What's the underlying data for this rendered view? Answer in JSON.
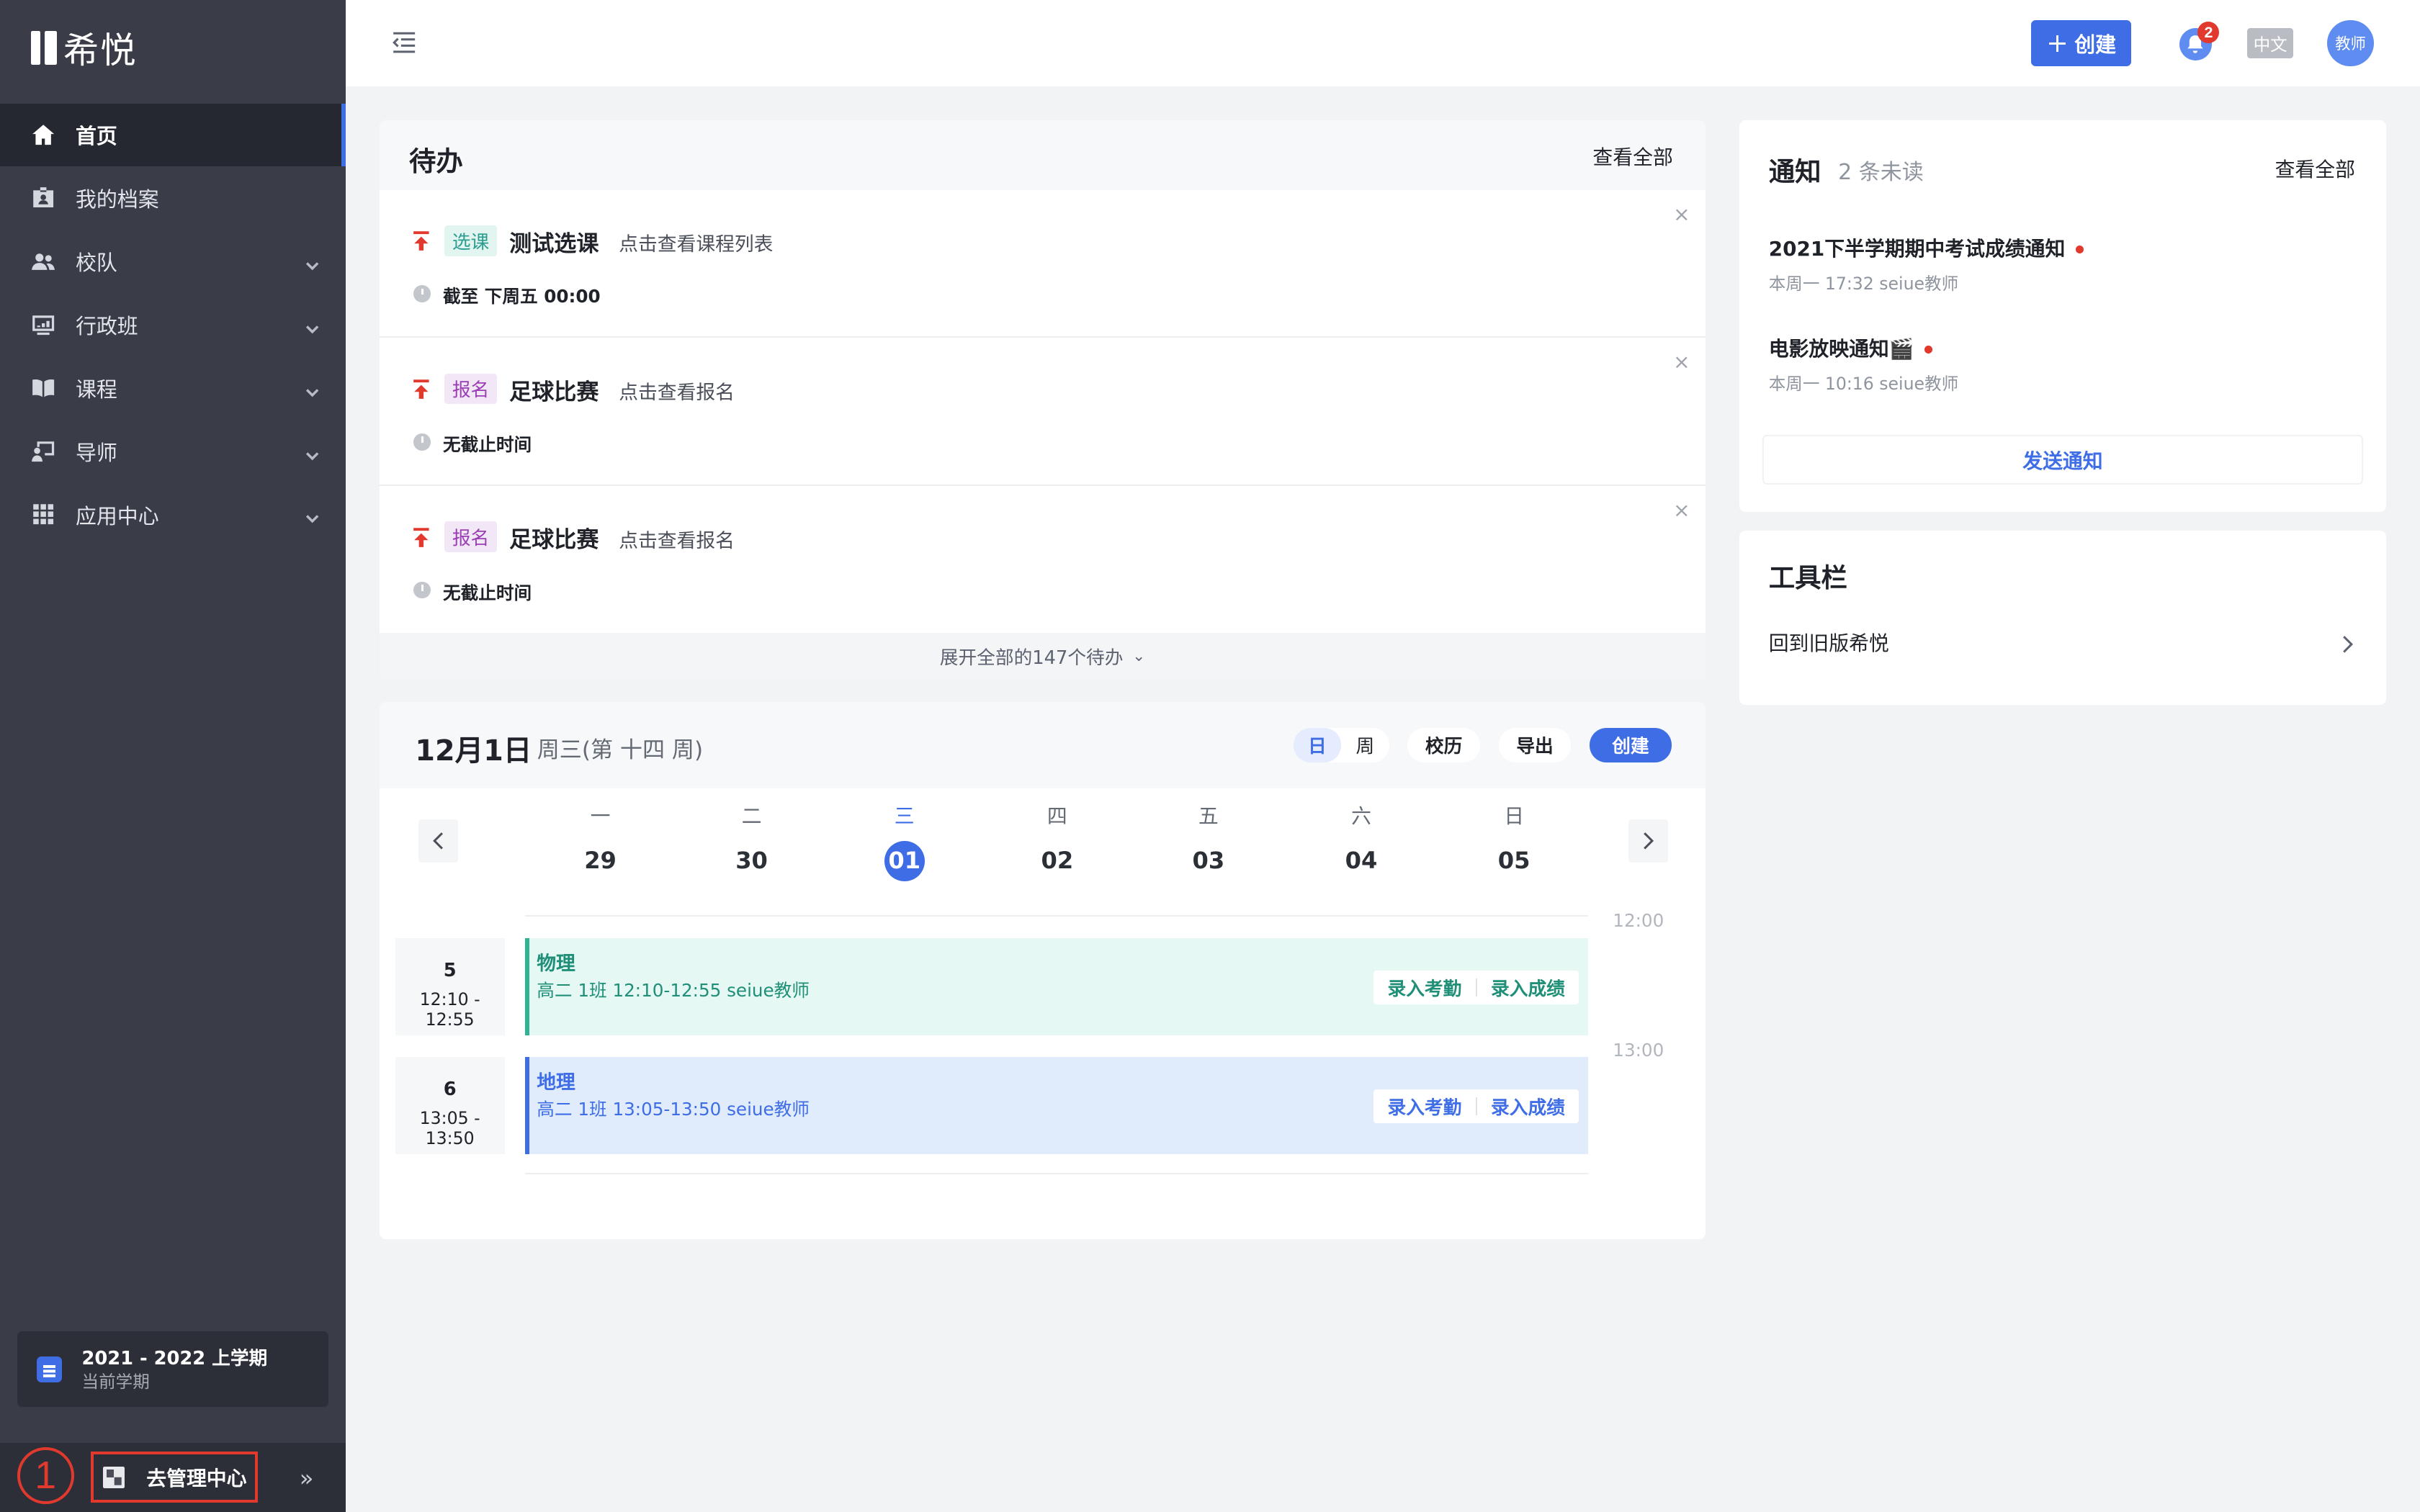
{
  "app": {
    "name": "希悦"
  },
  "sidebar": {
    "items": [
      {
        "label": "首页",
        "icon": "home-icon"
      },
      {
        "label": "我的档案",
        "icon": "id-card-icon"
      },
      {
        "label": "校队",
        "icon": "team-icon"
      },
      {
        "label": "行政班",
        "icon": "class-board-icon"
      },
      {
        "label": "课程",
        "icon": "book-icon"
      },
      {
        "label": "导师",
        "icon": "mentor-icon"
      },
      {
        "label": "应用中心",
        "icon": "apps-grid-icon"
      }
    ],
    "term": {
      "title": "2021 - 2022 上学期",
      "subtitle": "当前学期"
    },
    "annotation_number": "1",
    "admin_label": "去管理中心",
    "collapse_label": "»"
  },
  "topbar": {
    "create_label": "创建",
    "notification_count": "2",
    "language": "中文",
    "avatar_label": "教师"
  },
  "todo": {
    "title": "待办",
    "view_all": "查看全部",
    "items": [
      {
        "tag": "选课",
        "name": "测试选课",
        "link": "点击查看课程列表",
        "deadline": "截至 下周五 00:00"
      },
      {
        "tag": "报名",
        "name": "足球比赛",
        "link": "点击查看报名",
        "deadline": "无截止时间"
      },
      {
        "tag": "报名",
        "name": "足球比赛",
        "link": "点击查看报名",
        "deadline": "无截止时间"
      }
    ],
    "close_label": "×",
    "expand_label": "展开全部的147个待办"
  },
  "calendar": {
    "date": "12月1日",
    "weekday": "周三(第 十四 周)",
    "view_day": "日",
    "view_week": "周",
    "school_calendar": "校历",
    "export": "导出",
    "create": "创建",
    "days": [
      {
        "wk": "一",
        "num": "29"
      },
      {
        "wk": "二",
        "num": "30"
      },
      {
        "wk": "三",
        "num": "01"
      },
      {
        "wk": "四",
        "num": "02"
      },
      {
        "wk": "五",
        "num": "03"
      },
      {
        "wk": "六",
        "num": "04"
      },
      {
        "wk": "日",
        "num": "05"
      }
    ],
    "time_labels": [
      "12:00",
      "13:00"
    ],
    "periods": [
      {
        "num": "5",
        "time": "12:10 - 12:55",
        "subject": "物理",
        "info": "高二  1班  12:10-12:55  seiue教师",
        "action1": "录入考勤",
        "action2": "录入成绩"
      },
      {
        "num": "6",
        "time": "13:05 - 13:50",
        "subject": "地理",
        "info": "高二  1班  13:05-13:50  seiue教师",
        "action1": "录入考勤",
        "action2": "录入成绩"
      }
    ]
  },
  "notices": {
    "title": "通知",
    "unread": "2 条未读",
    "view_all": "查看全部",
    "items": [
      {
        "title": "2021下半学期期中考试成绩通知",
        "meta": "本周一 17:32  seiue教师"
      },
      {
        "title": "电影放映通知🎬",
        "meta": "本周一 10:16  seiue教师"
      }
    ],
    "send_label": "发送通知"
  },
  "toolbar": {
    "title": "工具栏",
    "item": "回到旧版希悦"
  },
  "colors": {
    "sidebar_bg": "#3a3d48",
    "accent": "#3e6de6",
    "annotation_red": "#e2392e",
    "lesson_green": "#2fb395"
  }
}
